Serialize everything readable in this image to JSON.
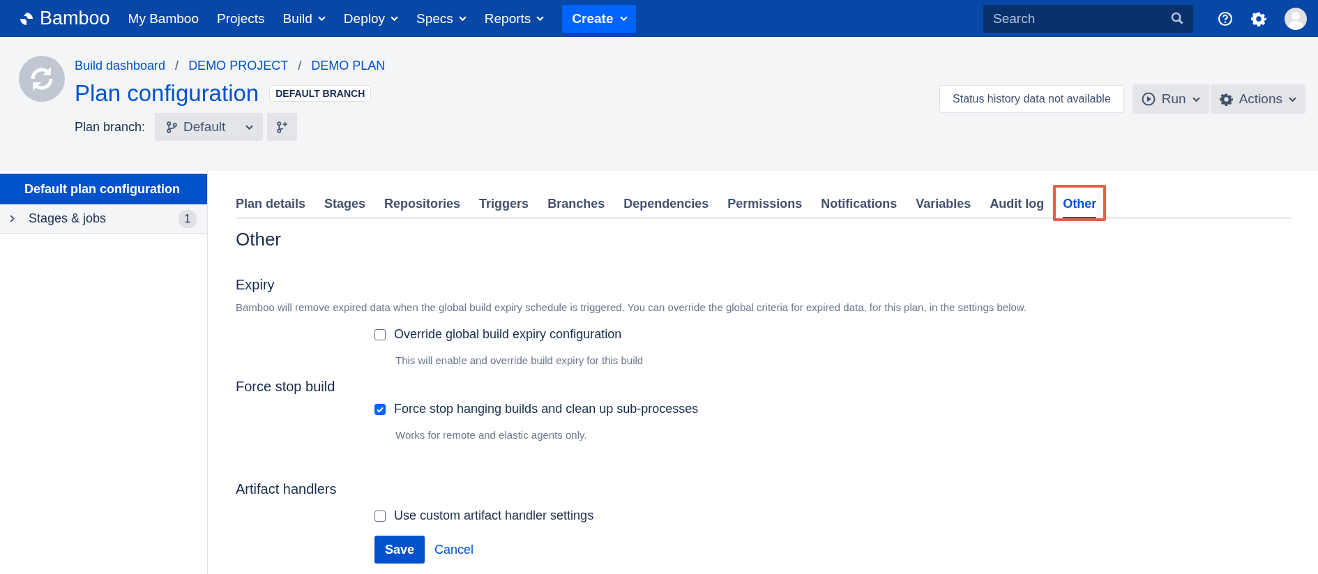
{
  "topbar": {
    "logo": "Bamboo",
    "nav": [
      {
        "label": "My Bamboo",
        "dropdown": false
      },
      {
        "label": "Projects",
        "dropdown": false
      },
      {
        "label": "Build",
        "dropdown": true
      },
      {
        "label": "Deploy",
        "dropdown": true
      },
      {
        "label": "Specs",
        "dropdown": true
      },
      {
        "label": "Reports",
        "dropdown": true
      }
    ],
    "create": "Create",
    "search": {
      "placeholder": "Search"
    }
  },
  "header": {
    "breadcrumbs": [
      {
        "label": "Build dashboard"
      },
      {
        "separator": "/",
        "label": "DEMO PROJECT"
      },
      {
        "separator": "/",
        "label": "DEMO PLAN"
      }
    ],
    "title": "Plan configuration",
    "badge": "DEFAULT BRANCH",
    "branch_label": "Plan branch:",
    "branch": "Default",
    "status": "Status history data not available",
    "run": "Run",
    "actions": "Actions"
  },
  "sidebar": {
    "items": [
      {
        "label": "Default plan configuration",
        "selected": true
      },
      {
        "label": "Stages & jobs",
        "selected": false,
        "count": "1"
      }
    ]
  },
  "tabs": [
    {
      "label": "Plan details",
      "selected": false,
      "highlighted": false
    },
    {
      "label": "Stages",
      "selected": false,
      "highlighted": false
    },
    {
      "label": "Repositories",
      "selected": false,
      "highlighted": false
    },
    {
      "label": "Triggers",
      "selected": false,
      "highlighted": false
    },
    {
      "label": "Branches",
      "selected": false,
      "highlighted": false
    },
    {
      "label": "Dependencies",
      "selected": false,
      "highlighted": false
    },
    {
      "label": "Permissions",
      "selected": false,
      "highlighted": false
    },
    {
      "label": "Notifications",
      "selected": false,
      "highlighted": false
    },
    {
      "label": "Variables",
      "selected": false,
      "highlighted": false
    },
    {
      "label": "Audit log",
      "selected": false,
      "highlighted": false
    },
    {
      "label": "Other",
      "selected": true,
      "highlighted": true
    }
  ],
  "page_title": "Other",
  "sections": [
    {
      "title": "Expiry",
      "description": "Bamboo will remove expired data when the global build expiry schedule is triggered. You can override the global criteria for expired data, for this plan, in the settings below.",
      "options": [
        {
          "label": "Override global build expiry configuration",
          "checked": false,
          "hint": "This will enable and override build expiry for this build"
        }
      ]
    },
    {
      "title": "Force stop build",
      "options": [
        {
          "label": "Force stop hanging builds and clean up sub-processes",
          "checked": true,
          "hint": "Works for remote and elastic agents only."
        }
      ]
    },
    {
      "title": "Artifact handlers",
      "options": [
        {
          "label": "Use custom artifact handler settings",
          "checked": false
        }
      ]
    }
  ],
  "buttons": {
    "save": "Save",
    "cancel": "Cancel"
  }
}
